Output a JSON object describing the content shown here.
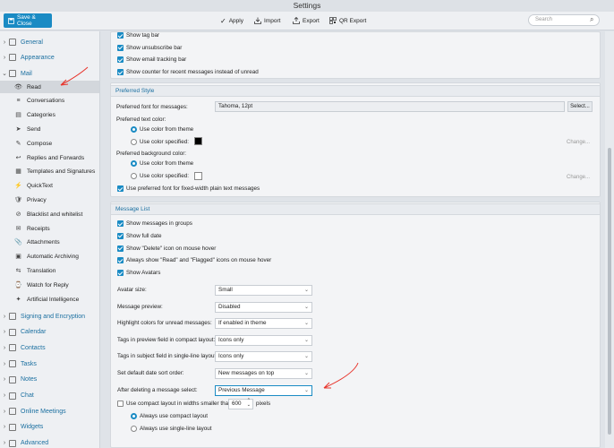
{
  "window": {
    "title": "Settings"
  },
  "toolbar": {
    "save_close": "Save & Close",
    "apply": "Apply",
    "import": "Import",
    "export": "Export",
    "qr_export": "QR Export",
    "search_placeholder": "Search"
  },
  "sidebar": {
    "general": "General",
    "appearance": "Appearance",
    "mail": "Mail",
    "mail_items": [
      "Read",
      "Conversations",
      "Categories",
      "Send",
      "Compose",
      "Replies and Forwards",
      "Templates and Signatures",
      "QuickText",
      "Privacy",
      "Blacklist and whitelist",
      "Receipts",
      "Attachments",
      "Automatic Archiving",
      "Translation",
      "Watch for Reply",
      "Artificial Intelligence"
    ],
    "bottom_items": [
      "Signing and Encryption",
      "Calendar",
      "Contacts",
      "Tasks",
      "Notes",
      "Chat",
      "Online Meetings",
      "Widgets",
      "Advanced"
    ]
  },
  "top_options": [
    "Show tag bar",
    "Show unsubscribe bar",
    "Show email tracking bar",
    "Show counter for recent messages instead of unread"
  ],
  "preferred_style": {
    "header": "Preferred Style",
    "font_label": "Preferred font for messages:",
    "font_value": "Tahoma, 12pt",
    "select_btn": "Select...",
    "text_color_label": "Preferred text color:",
    "use_theme": "Use color from theme",
    "use_specified": "Use color specified:",
    "change": "Change...",
    "text_color": "#000000",
    "bg_color_label": "Preferred background color:",
    "bg_color": "#ffffff",
    "fixed_width": "Use preferred font for fixed-width plain text messages"
  },
  "message_list": {
    "header": "Message List",
    "checks": [
      "Show messages in groups",
      "Show full date",
      "Show \"Delete\" icon on mouse hover",
      "Always show \"Read\" and \"Flagged\" icons on mouse hover",
      "Show Avatars"
    ],
    "settings": [
      {
        "label": "Avatar size:",
        "value": "Small"
      },
      {
        "label": "Message preview:",
        "value": "Disabled"
      },
      {
        "label": "Highlight colors for unread messages:",
        "value": "If enabled in theme"
      },
      {
        "label": "Tags in preview field in compact layout:",
        "value": "Icons only"
      },
      {
        "label": "Tags in subject field in single-line layout:",
        "value": "Icons only"
      },
      {
        "label": "Set default date sort order:",
        "value": "New messages on top"
      },
      {
        "label": "After deleting a message select:",
        "value": "Previous Message"
      }
    ],
    "compact_label": "Use compact layout in widths smaller than",
    "compact_value": "600",
    "compact_unit": "pixels",
    "always_compact": "Always use compact layout",
    "always_single": "Always use single-line layout"
  },
  "colors": {
    "accent": "#1a8bc4",
    "annotation": "#e8332a"
  }
}
